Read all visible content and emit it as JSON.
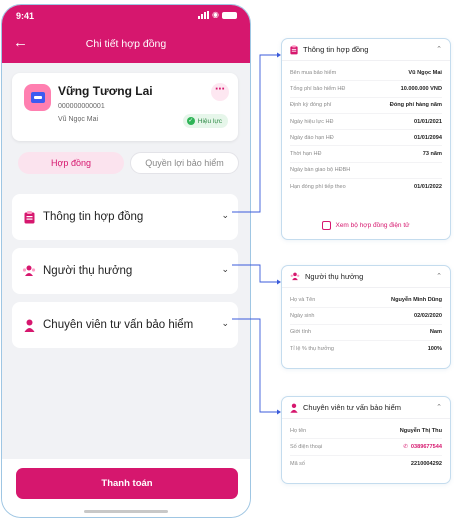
{
  "status_bar": {
    "time": "9:41"
  },
  "header": {
    "title": "Chi tiết hợp đồng"
  },
  "profile": {
    "name": "Vững Tương Lai",
    "id": "000000000001",
    "holder": "Vũ Ngọc Mai",
    "status": "Hiệu lực"
  },
  "tabs": [
    {
      "label": "Hợp đồng",
      "active": true
    },
    {
      "label": "Quyền lợi bảo hiểm",
      "active": false
    }
  ],
  "sections": [
    {
      "label": "Thông tin hợp đồng",
      "icon": "clipboard-icon"
    },
    {
      "label": "Người thụ hưởng",
      "icon": "people-icon"
    },
    {
      "label": "Chuyên viên tư vấn bảo hiểm",
      "icon": "person-icon"
    }
  ],
  "pay_button": "Thanh toán",
  "contract_panel": {
    "title": "Thông tin hợp đồng",
    "rows": [
      {
        "label": "Bên mua bảo hiểm",
        "value": "Vũ Ngọc Mai"
      },
      {
        "label": "Tổng phí bảo hiểm HĐ",
        "value": "10.000.000 VND"
      },
      {
        "label": "Định kỳ đóng phí",
        "value": "Đóng phí hàng năm"
      },
      {
        "label": "Ngày hiệu lực HĐ",
        "value": "01/01/2021"
      },
      {
        "label": "Ngày đáo hạn HĐ",
        "value": "01/01/2094"
      },
      {
        "label": "Thời hạn HĐ",
        "value": "73 năm"
      },
      {
        "label": "Ngày bàn giao bộ HĐBH",
        "value": ""
      },
      {
        "label": "Hạn đóng phí tiếp theo",
        "value": "01/01/2022"
      }
    ],
    "link": "Xem bộ hợp đồng điện tử"
  },
  "beneficiary_panel": {
    "title": "Người thụ hưởng",
    "rows": [
      {
        "label": "Họ và Tên",
        "value": "Nguyễn Minh Dũng"
      },
      {
        "label": "Ngày sinh",
        "value": "02/02/2020"
      },
      {
        "label": "Giới tính",
        "value": "Nam"
      },
      {
        "label": "Tỉ lệ % thụ hưởng",
        "value": "100%"
      }
    ]
  },
  "advisor_panel": {
    "title": "Chuyên viên tư vấn bảo hiểm",
    "rows": [
      {
        "label": "Họ tên",
        "value": "Nguyễn Thị Thu"
      },
      {
        "label": "Số điện thoại",
        "value": "0389677544"
      },
      {
        "label": "Mã số",
        "value": "2210004292"
      }
    ]
  },
  "colors": {
    "brand": "#d6176e",
    "accent_blue": "#3d5af1",
    "success": "#2fb457",
    "connector": "#3b5bdb"
  }
}
